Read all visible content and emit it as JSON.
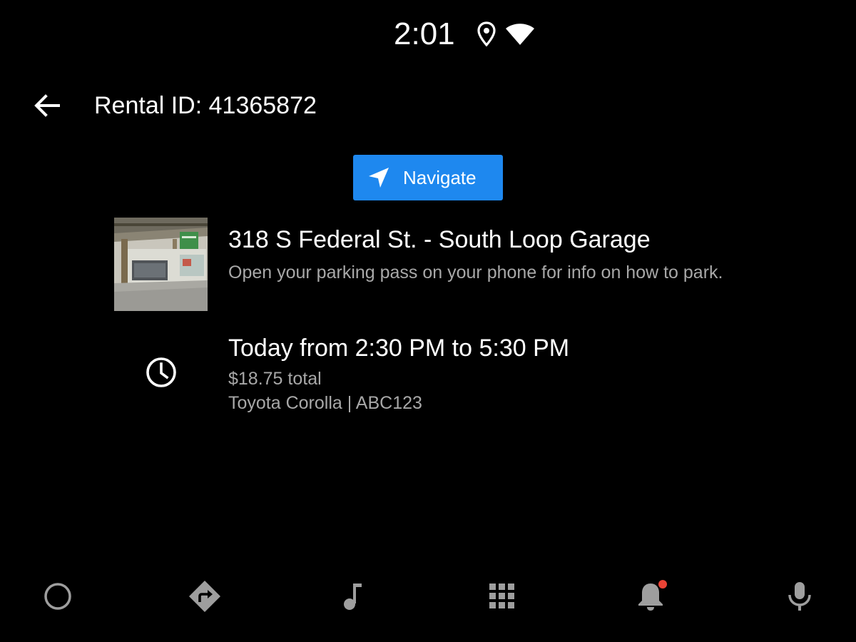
{
  "status_bar": {
    "time": "2:01",
    "icons": [
      "location-icon",
      "wifi-icon"
    ]
  },
  "header": {
    "back_icon": "arrow-back-icon",
    "title": "Rental ID: 41365872"
  },
  "navigate_button": {
    "icon": "navigation-arrow-icon",
    "label": "Navigate",
    "color": "#1e88ef"
  },
  "location": {
    "image": "garage-photo",
    "title": "318 S Federal St. - South Loop Garage",
    "subtitle": "Open your parking pass on your phone for info on how to park."
  },
  "reservation": {
    "icon": "clock-icon",
    "time": "Today from 2:30 PM to 5:30 PM",
    "price": "$18.75 total",
    "vehicle": "Toyota Corolla | ABC123"
  },
  "nav_bar": {
    "items": [
      {
        "name": "home",
        "icon": "circle-home-icon"
      },
      {
        "name": "navigation",
        "icon": "directions-icon"
      },
      {
        "name": "media",
        "icon": "music-note-icon"
      },
      {
        "name": "apps",
        "icon": "app-grid-icon"
      },
      {
        "name": "notifications",
        "icon": "bell-icon",
        "badge": true,
        "badge_color": "#ea4335"
      },
      {
        "name": "assistant",
        "icon": "microphone-icon"
      }
    ],
    "icon_color": "#9e9e9e"
  }
}
